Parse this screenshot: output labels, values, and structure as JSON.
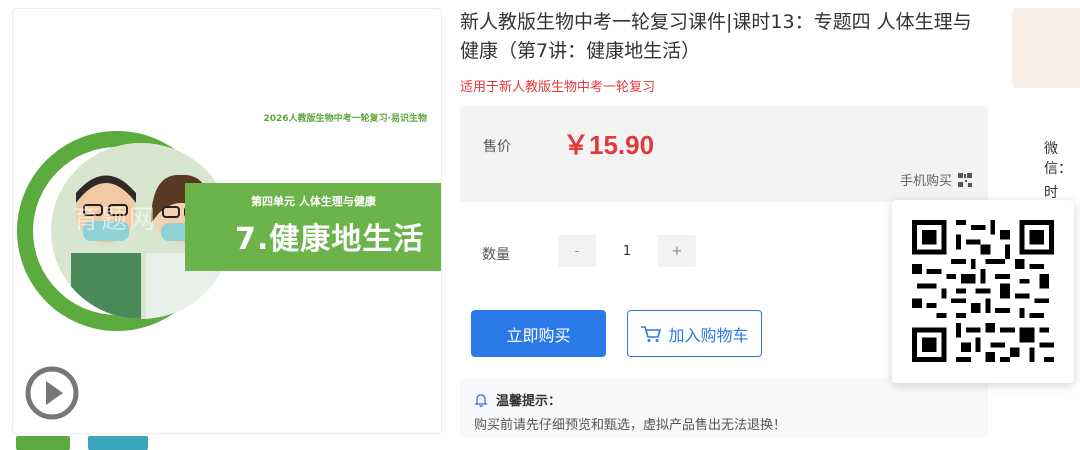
{
  "product": {
    "title": "新人教版生物中考一轮复习课件|课时13：专题四 人体生理与健康（第7讲：健康地生活）",
    "subtitle": "适用于新人教版生物中考一轮复习"
  },
  "cover": {
    "series": "2026人教版生物中考一轮复习·易识生物",
    "unit": "第四单元  人体生理与健康",
    "lesson": "7.健康地生活",
    "watermark": "育题网"
  },
  "price": {
    "label": "售价",
    "value": "￥15.90",
    "mobile_buy": "手机购买"
  },
  "quantity": {
    "label": "数量",
    "minus": "-",
    "plus": "+",
    "value": "1"
  },
  "actions": {
    "buy": "立即购买",
    "cart": "加入购物车"
  },
  "tip": {
    "title": "温馨提示：",
    "text": "购买前请先仔细预览和甄选，虚拟产品售出无法退换！"
  },
  "side": {
    "wechat": "微信：",
    "time": "时间：",
    "colon": ":"
  },
  "colors": {
    "accent_blue": "#2b79e8",
    "price_red": "#e4393c",
    "cover_green": "#6bb34a"
  }
}
